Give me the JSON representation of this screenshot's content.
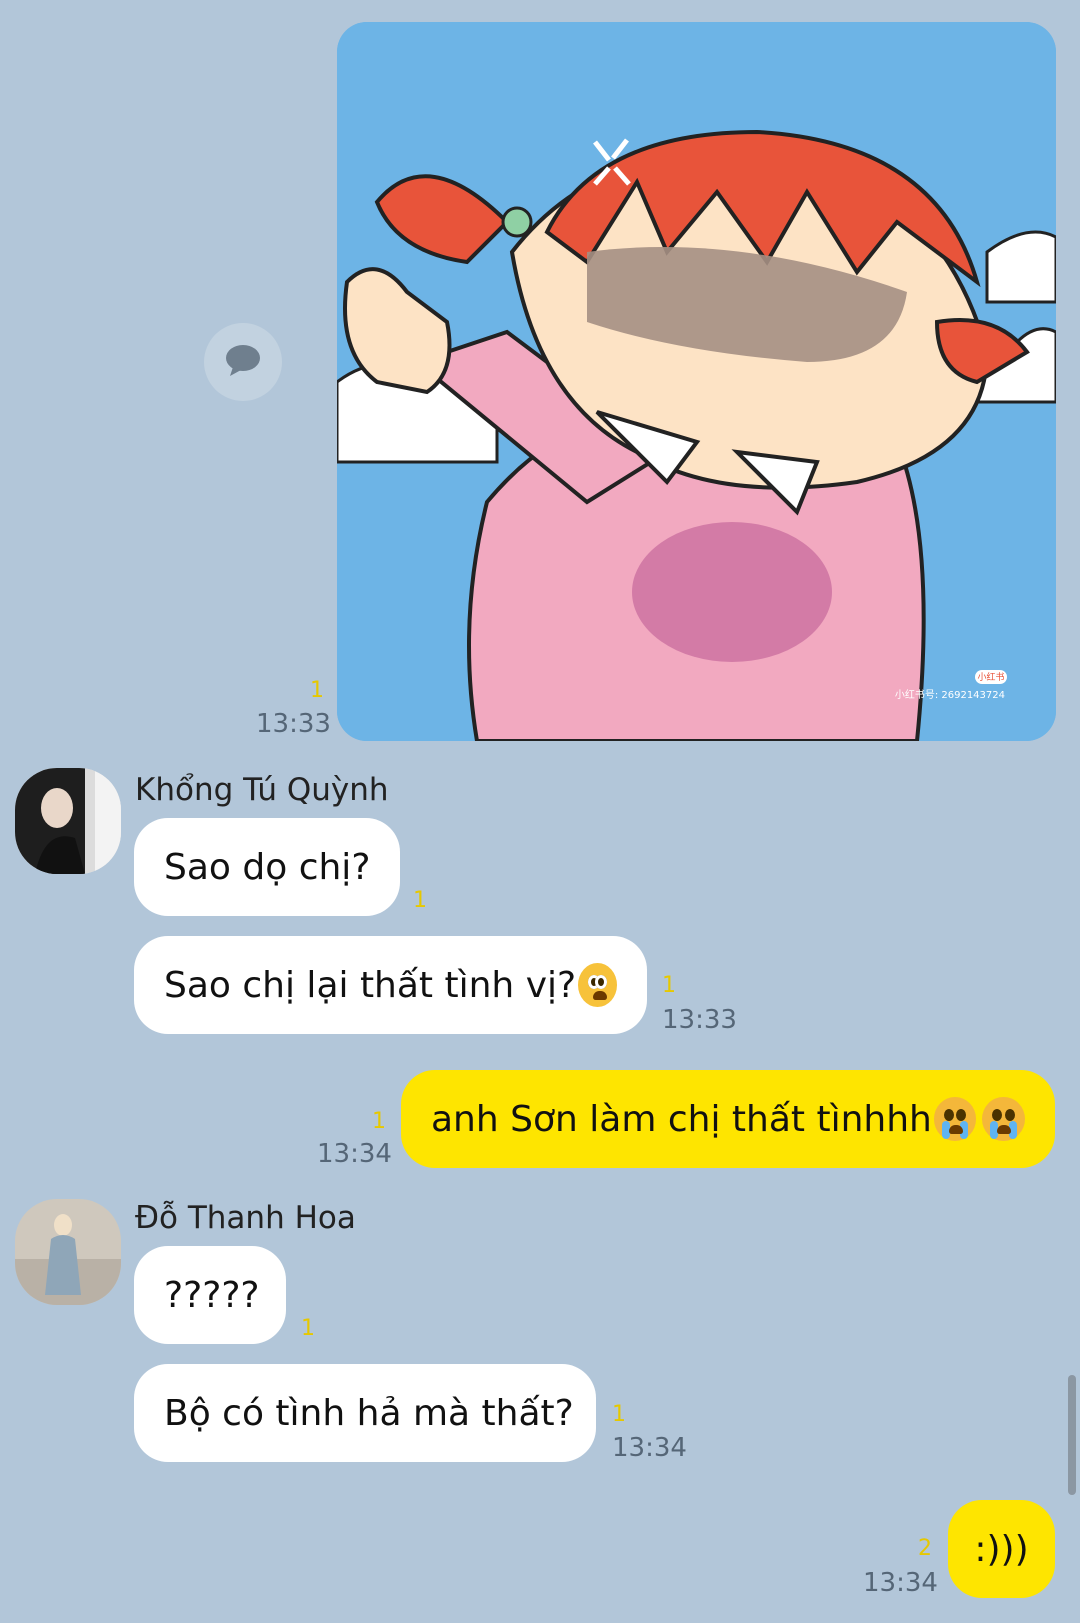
{
  "messages": {
    "image": {
      "unread": "1",
      "time": "13:33",
      "watermark_badge": "小红书",
      "watermark_id": "小红书号: 2692143724"
    },
    "group1": {
      "sender": "Khổng Tú Quỳnh",
      "bubble1": {
        "text": "Sao dọ chị?",
        "unread": "1"
      },
      "bubble2": {
        "text": "Sao chị lại thất tình vị?",
        "emoji": "pleading-face",
        "unread": "1",
        "time": "13:33"
      }
    },
    "outgoing1": {
      "text": "anh Sơn làm chị thất tìnhhh",
      "emoji": [
        "loudly-crying-face",
        "loudly-crying-face"
      ],
      "unread": "1",
      "time": "13:34"
    },
    "group2": {
      "sender": "Đỗ Thanh Hoa",
      "bubble1": {
        "text": "?????",
        "unread": "1"
      },
      "bubble2": {
        "text": "Bộ có tình hả mà thất?",
        "unread": "1",
        "time": "13:34"
      }
    },
    "outgoing2": {
      "text": ":)))",
      "unread": "2",
      "time": "13:34"
    }
  },
  "colors": {
    "background": "#b2c6d9",
    "incoming_bubble": "#ffffff",
    "outgoing_bubble": "#fee500",
    "unread_count": "#e6c800"
  },
  "icons": {
    "reply": "speech-bubble-icon"
  }
}
